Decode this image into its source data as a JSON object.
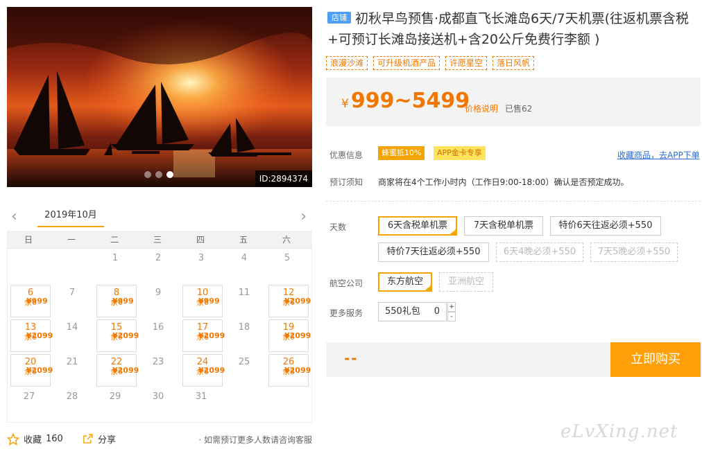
{
  "hero": {
    "id_label": "ID:2894374"
  },
  "calendar": {
    "month": "2019年10月",
    "weekdays": [
      "日",
      "一",
      "二",
      "三",
      "四",
      "五",
      "六"
    ],
    "cells": [
      {
        "day": ""
      },
      {
        "day": ""
      },
      {
        "day": "1"
      },
      {
        "day": "2"
      },
      {
        "day": "3"
      },
      {
        "day": "4"
      },
      {
        "day": "5"
      },
      {
        "day": "6",
        "price": "¥999",
        "stock": "余6"
      },
      {
        "day": "7"
      },
      {
        "day": "8",
        "price": "¥999",
        "stock": "余6"
      },
      {
        "day": "9"
      },
      {
        "day": "10",
        "price": "¥999",
        "stock": "余6"
      },
      {
        "day": "11"
      },
      {
        "day": "12",
        "price": "¥2099",
        "stock": "余6"
      },
      {
        "day": "13",
        "price": "¥2099",
        "stock": "余6"
      },
      {
        "day": "14"
      },
      {
        "day": "15",
        "price": "¥2099",
        "stock": "余6"
      },
      {
        "day": "16"
      },
      {
        "day": "17",
        "price": "¥2099",
        "stock": "余6"
      },
      {
        "day": "18"
      },
      {
        "day": "19",
        "price": "¥2099",
        "stock": "余6"
      },
      {
        "day": "20",
        "price": "¥2099",
        "stock": "余6"
      },
      {
        "day": "21"
      },
      {
        "day": "22",
        "price": "¥2099",
        "stock": "余6"
      },
      {
        "day": "23"
      },
      {
        "day": "24",
        "price": "¥2099",
        "stock": "余6"
      },
      {
        "day": "25"
      },
      {
        "day": "26",
        "price": "¥2099",
        "stock": "余8"
      },
      {
        "day": "27"
      },
      {
        "day": "28"
      },
      {
        "day": "29"
      },
      {
        "day": "30"
      },
      {
        "day": "31"
      },
      {
        "day": ""
      },
      {
        "day": ""
      }
    ]
  },
  "footer": {
    "fav_label": "收藏",
    "fav_count": "160",
    "share_label": "分享",
    "contact_note": "· 如需预订更多人数请咨询客服"
  },
  "product": {
    "shop_badge": "店铺",
    "title": "初秋早鸟预售·成都直飞长滩岛6天/7天机票(往返机票含税+可预订长滩岛接送机+含20公斤免费行李额 )",
    "tags": [
      "浪漫沙滩",
      "可升级机酒产品",
      "许愿星空",
      "落日风帆"
    ],
    "price_currency": "¥",
    "price_range": "999~5499",
    "price_note": "价格说明",
    "sold": "已售62"
  },
  "promo": {
    "label": "优惠信息",
    "badge_a": "蜂蜜抵10%",
    "badge_b": "APP金卡专享",
    "app_link": "收藏商品，去APP下单"
  },
  "booking": {
    "label": "预订须知",
    "notice": "商家将在4个工作小时内（工作日9:00-18:00）确认是否预定成功。"
  },
  "options": {
    "days_label": "天数",
    "days": [
      "6天含税单机票",
      "7天含税单机票",
      "特价6天往返必须+550",
      "特价7天往返必须+550",
      "6天4晚必须+550",
      "7天5晚必须+550"
    ],
    "airline_label": "航空公司",
    "airlines": [
      "东方航空",
      "亚洲航空"
    ],
    "service_label": "更多服务",
    "service_name": "550礼包",
    "service_qty": "0",
    "plus": "+",
    "minus": "-"
  },
  "buy": {
    "total": "--",
    "button": "立即购买"
  },
  "watermark": "eLvXing.net",
  "colors": {
    "accent": "#f5a400",
    "price": "#f07800",
    "link": "#2b6ad4",
    "badge": "#4e9ff5"
  }
}
